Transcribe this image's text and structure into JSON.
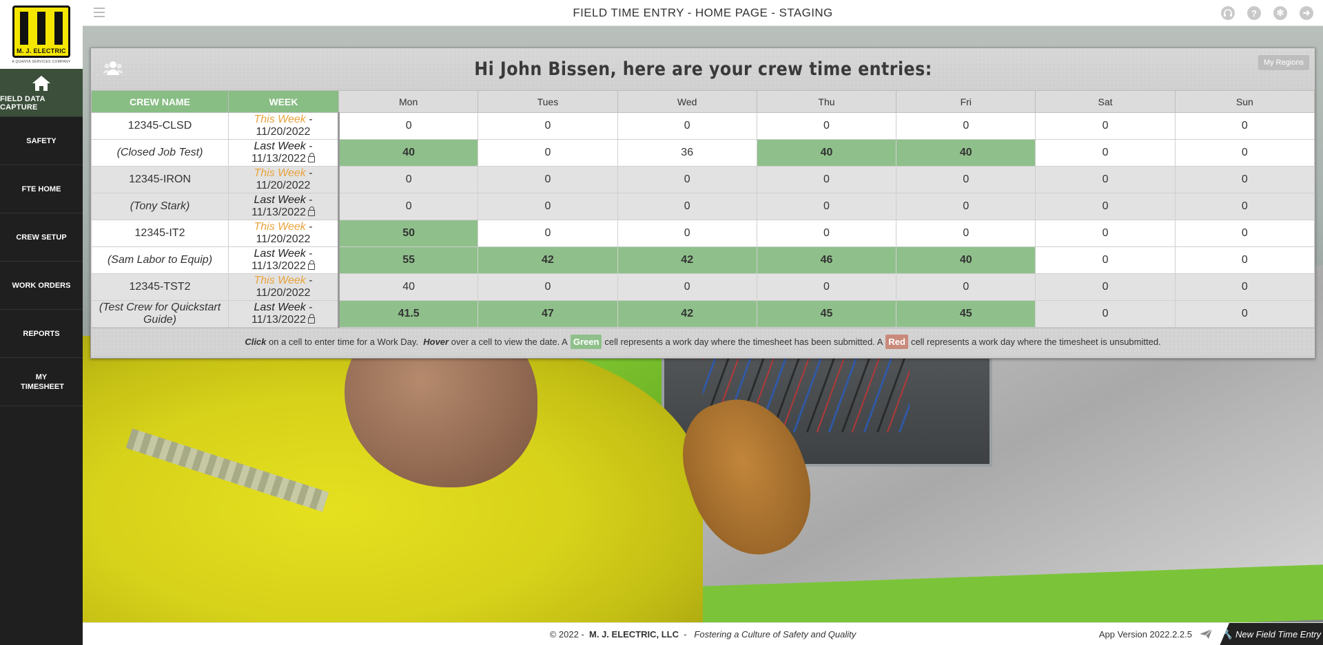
{
  "sidebar": {
    "logo_text": "M. J. ELECTRIC",
    "logo_sub": "A QUANTA SERVICES COMPANY",
    "home_label": "FIELD DATA CAPTURE",
    "items": [
      {
        "label": "SAFETY"
      },
      {
        "label": "FTE HOME"
      },
      {
        "label": "CREW SETUP"
      },
      {
        "label": "WORK ORDERS"
      },
      {
        "label": "REPORTS"
      },
      {
        "label": "MY TIMESHEET"
      }
    ]
  },
  "header": {
    "title": "FIELD TIME ENTRY - HOME PAGE - STAGING",
    "icons": [
      "headset-icon",
      "help-icon",
      "settings-icon",
      "logout-icon"
    ]
  },
  "panel": {
    "greeting": "Hi John Bissen, here are your crew time entries:",
    "my_regions": "My Regions",
    "columns": {
      "crew": "CREW NAME",
      "week": "WEEK",
      "days": [
        "Mon",
        "Tues",
        "Wed",
        "Thu",
        "Fri",
        "Sat",
        "Sun"
      ]
    },
    "crews": [
      {
        "name": "12345-CLSD",
        "desc": "(Closed Job Test)",
        "this_week": {
          "label": "This Week",
          "date": "11/20/2022",
          "hours": [
            "0",
            "0",
            "0",
            "0",
            "0",
            "0",
            "0"
          ],
          "submitted": [
            false,
            false,
            false,
            false,
            false,
            false,
            false
          ]
        },
        "last_week": {
          "label": "Last Week",
          "date": "11/13/2022",
          "hours": [
            "40",
            "0",
            "36",
            "40",
            "40",
            "0",
            "0"
          ],
          "submitted": [
            true,
            false,
            false,
            true,
            true,
            false,
            false
          ]
        }
      },
      {
        "name": "12345-IRON",
        "desc": "(Tony Stark)",
        "this_week": {
          "label": "This Week",
          "date": "11/20/2022",
          "hours": [
            "0",
            "0",
            "0",
            "0",
            "0",
            "0",
            "0"
          ],
          "submitted": [
            false,
            false,
            false,
            false,
            false,
            false,
            false
          ]
        },
        "last_week": {
          "label": "Last Week",
          "date": "11/13/2022",
          "hours": [
            "0",
            "0",
            "0",
            "0",
            "0",
            "0",
            "0"
          ],
          "submitted": [
            false,
            false,
            false,
            false,
            false,
            false,
            false
          ]
        }
      },
      {
        "name": "12345-IT2",
        "desc": "(Sam Labor to Equip)",
        "this_week": {
          "label": "This Week",
          "date": "11/20/2022",
          "hours": [
            "50",
            "0",
            "0",
            "0",
            "0",
            "0",
            "0"
          ],
          "submitted": [
            true,
            false,
            false,
            false,
            false,
            false,
            false
          ]
        },
        "last_week": {
          "label": "Last Week",
          "date": "11/13/2022",
          "hours": [
            "55",
            "42",
            "42",
            "46",
            "40",
            "0",
            "0"
          ],
          "submitted": [
            true,
            true,
            true,
            true,
            true,
            false,
            false
          ]
        }
      },
      {
        "name": "12345-TST2",
        "desc": "(Test Crew for Quickstart Guide)",
        "this_week": {
          "label": "This Week",
          "date": "11/20/2022",
          "hours": [
            "40",
            "0",
            "0",
            "0",
            "0",
            "0",
            "0"
          ],
          "submitted": [
            false,
            false,
            false,
            false,
            false,
            false,
            false
          ]
        },
        "last_week": {
          "label": "Last Week",
          "date": "11/13/2022",
          "hours": [
            "41.5",
            "47",
            "42",
            "45",
            "45",
            "0",
            "0"
          ],
          "submitted": [
            true,
            true,
            true,
            true,
            true,
            false,
            false
          ]
        }
      }
    ],
    "legend": {
      "click": "Click",
      "click_text": "on a cell to enter time for a Work Day.",
      "hover": "Hover",
      "hover_text": "over a cell to view the date.  A",
      "green": "Green",
      "green_text": "cell represents a work day where the timesheet has been submitted. A",
      "red": "Red",
      "red_text": "cell represents a work day where the timesheet is unsubmitted."
    }
  },
  "footer": {
    "copyright": "© 2022  -",
    "company": "M. J. ELECTRIC, LLC",
    "tagline": "Fostering a Culture of Safety and Quality",
    "version": "App Version 2022.2.2.5",
    "new_entry": "New Field Time Entry"
  },
  "colors": {
    "submitted": "#8fc08b",
    "unsubmitted": "#c98a7b",
    "header_green": "#88bd84",
    "link_blue": "#3b8bc2"
  }
}
